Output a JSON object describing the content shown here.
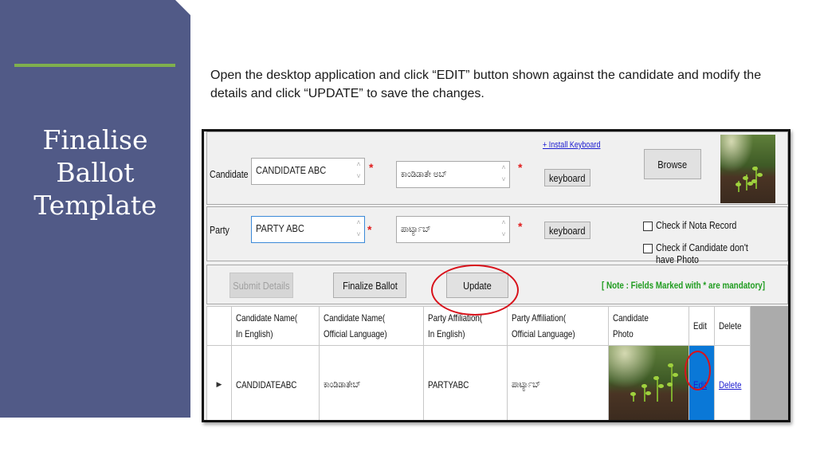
{
  "slide": {
    "title_lines": [
      "Finalise",
      "Ballot",
      "Template"
    ],
    "instructions": "Open the desktop application and click “EDIT” button shown against the candidate and modify the details and click “UPDATE” to save the changes.",
    "accent_color": "#7fb04d",
    "sidebar_color": "#515a87"
  },
  "app": {
    "candidate": {
      "label": "Candidate",
      "english_value": "CANDIDATE ABC",
      "official_value": "ಕಾಂಡಿಡಾತೇ ಅಬ್",
      "required_mark": "*",
      "keyboard_label": "keyboard",
      "install_keyboard_link": "+ Install Keyboard",
      "browse_label": "Browse"
    },
    "party": {
      "label": "Party",
      "english_value": "PARTY ABC",
      "official_value": "ಪಾರ್ಟ್ಯಾಬ್",
      "required_mark": "*",
      "keyboard_label": "keyboard",
      "checkbox_nota": "Check if Nota Record",
      "checkbox_no_photo": "Check if Candidate don't have Photo"
    },
    "actions": {
      "submit_label": "Submit Details",
      "finalize_label": "Finalize Ballot",
      "update_label": "Update",
      "note": "[ Note : Fields Marked with * are mandatory]"
    },
    "grid": {
      "headers": [
        [
          "Candidate Name(",
          "In English)"
        ],
        [
          "Candidate Name(",
          "Official Language)"
        ],
        [
          "Party Affiliation(",
          "In English)"
        ],
        [
          "Party Affiliation(",
          "Official Language)"
        ],
        [
          "Candidate",
          "Photo"
        ],
        [
          "Edit",
          ""
        ],
        [
          "Delete",
          ""
        ]
      ],
      "rows": [
        {
          "indicator": "▶",
          "candidate_en": "CANDIDATEABC",
          "candidate_official": "ಕಾಂಡಿಡಾತೇಬ್",
          "party_en": "PARTYABC",
          "party_official": "ಪಾರ್ಟ್ಯಾಬ್",
          "edit_label": "Edit",
          "delete_label": "Delete"
        }
      ]
    }
  }
}
